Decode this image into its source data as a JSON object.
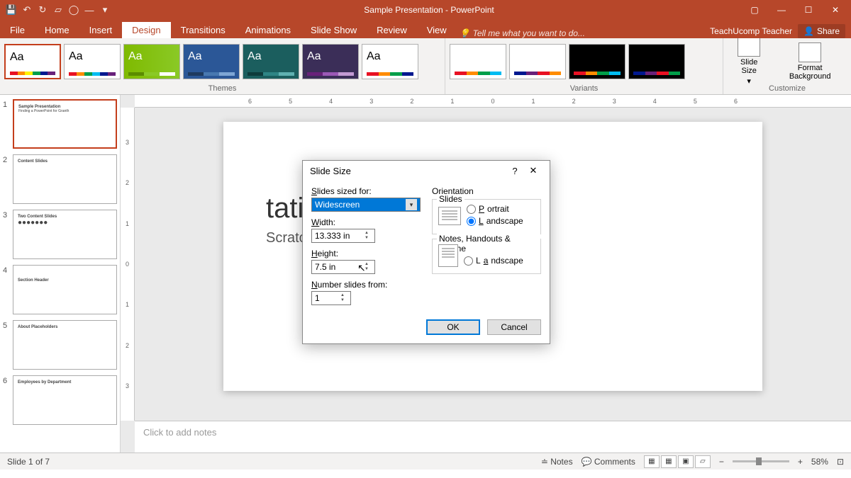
{
  "app": {
    "title": "Sample Presentation - PowerPoint"
  },
  "ribbon": {
    "tabs": [
      "File",
      "Home",
      "Insert",
      "Design",
      "Transitions",
      "Animations",
      "Slide Show",
      "Review",
      "View"
    ],
    "tellme": "Tell me what you want to do...",
    "account": "TeachUcomp Teacher",
    "share": "Share"
  },
  "groups": {
    "themes": "Themes",
    "variants": "Variants",
    "customize": "Customize",
    "slidesize": "Slide Size",
    "format": "Format Background"
  },
  "thumbnails": [
    {
      "n": "1",
      "title": "Sample Presentation"
    },
    {
      "n": "2",
      "title": "Content Slides"
    },
    {
      "n": "3",
      "title": "Two Content Slides"
    },
    {
      "n": "4",
      "title": "Section Header"
    },
    {
      "n": "5",
      "title": "About Placeholders"
    },
    {
      "n": "6",
      "title": "Employees by Department"
    }
  ],
  "canvas": {
    "title": "tation",
    "subtitle": "Scratch"
  },
  "notes_placeholder": "Click to add notes",
  "status": {
    "slide": "Slide 1 of 7",
    "notes": "Notes",
    "comments": "Comments",
    "zoom": "58%"
  },
  "ruler_h": [
    "6",
    "5",
    "4",
    "3",
    "2",
    "1",
    "0",
    "1",
    "2",
    "3",
    "4",
    "5",
    "6"
  ],
  "ruler_v": [
    "3",
    "2",
    "1",
    "0",
    "1",
    "2",
    "3"
  ],
  "dialog": {
    "title": "Slide Size",
    "sized_for_label": "Slides sized for:",
    "sized_for_value": "Widescreen",
    "width_label": "Width:",
    "width_value": "13.333 in",
    "height_label": "Height:",
    "height_value": "7.5 in",
    "number_label": "Number slides from:",
    "number_value": "1",
    "orientation": "Orientation",
    "slides_legend": "Slides",
    "notes_legend": "Notes, Handouts & Outline",
    "portrait": "Portrait",
    "landscape": "Landscape",
    "ok": "OK",
    "cancel": "Cancel"
  }
}
